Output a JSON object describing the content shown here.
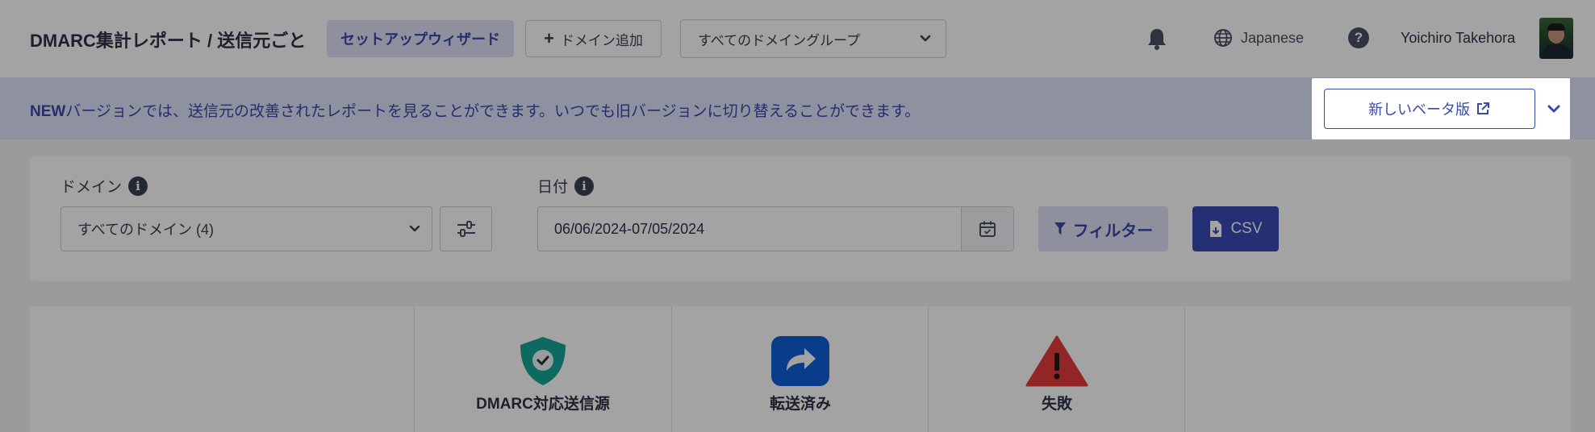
{
  "header": {
    "title": "DMARC集計レポート / 送信元ごと",
    "setup_wizard_label": "セットアップウィザード",
    "add_domain_label": "ドメイン追加",
    "domain_group_select": {
      "selected": "すべてのドメイングループ"
    },
    "language": "Japanese",
    "help_symbol": "?",
    "user_name": "Yoichiro Takehora"
  },
  "banner": {
    "new_tag": "NEW",
    "message": "バージョンでは、送信元の改善されたレポートを見ることができます。いつでも旧バージョンに切り替えることができます。",
    "beta_button_label": "新しいベータ版"
  },
  "filters": {
    "domain_label": "ドメイン",
    "domain_select": {
      "selected": "すべてのドメイン (4)"
    },
    "date_label": "日付",
    "date_value": "06/06/2024-07/05/2024",
    "filter_button_label": "フィルター",
    "csv_button_label": "CSV"
  },
  "stats": [
    {
      "label": "DMARC対応送信源",
      "icon": "shield-check-icon",
      "color": "#16a596"
    },
    {
      "label": "転送済み",
      "icon": "forward-arrow-icon",
      "color": "#0f5fd6"
    },
    {
      "label": "失敗",
      "icon": "warning-triangle-icon",
      "color": "#e53a3a"
    }
  ],
  "colors": {
    "accent": "#3b49a8",
    "banner_background": "#dfe4fb",
    "csv_button": "#3b4ab5"
  }
}
